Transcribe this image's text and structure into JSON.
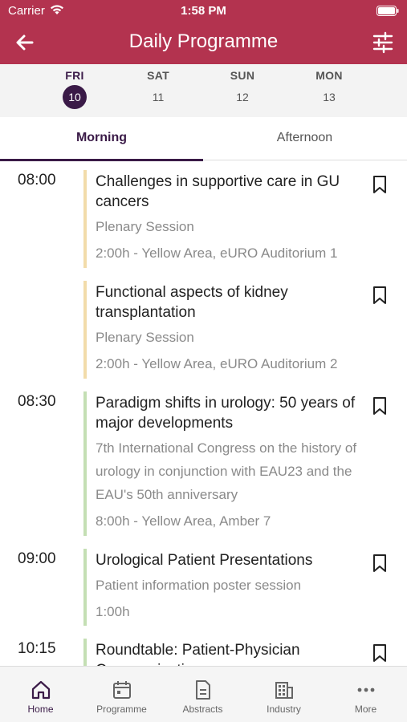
{
  "status": {
    "carrier": "Carrier",
    "time": "1:58 PM"
  },
  "header": {
    "title": "Daily Programme"
  },
  "days": [
    {
      "name": "FRI",
      "num": "10",
      "active": true
    },
    {
      "name": "SAT",
      "num": "11",
      "active": false
    },
    {
      "name": "SUN",
      "num": "12",
      "active": false
    },
    {
      "name": "MON",
      "num": "13",
      "active": false
    }
  ],
  "tabs": {
    "morning": "Morning",
    "afternoon": "Afternoon"
  },
  "sessions": [
    {
      "time": "08:00",
      "title": "Challenges in supportive care in GU cancers",
      "type": "Plenary Session",
      "meta": "2:00h - Yellow Area, eURO Auditorium 1",
      "color": "#f2dcaa"
    },
    {
      "time": "",
      "title": "Functional aspects of kidney transplantation",
      "type": "Plenary Session",
      "meta": "2:00h - Yellow Area, eURO Auditorium 2",
      "color": "#f2dcaa"
    },
    {
      "time": "08:30",
      "title": "Paradigm shifts in urology: 50 years of major developments",
      "type": "7th International Congress on the history of urology in conjunction with EAU23 and the EAU's 50th anniversary",
      "meta": "8:00h - Yellow Area, Amber 7",
      "color": "#c4dfb4"
    },
    {
      "time": "09:00",
      "title": "Urological Patient Presentations",
      "type": "Patient information poster session",
      "meta": "1:00h",
      "color": "#c4dfb4"
    },
    {
      "time": "10:15",
      "title": "Roundtable: Patient-Physician Communication",
      "type": "",
      "meta": "",
      "color": "#c4dfb4"
    }
  ],
  "tabbar": {
    "home": "Home",
    "programme": "Programme",
    "abstracts": "Abstracts",
    "industry": "Industry",
    "more": "More"
  },
  "colors": {
    "header": "#b3334f",
    "accent": "#3a1a47"
  }
}
